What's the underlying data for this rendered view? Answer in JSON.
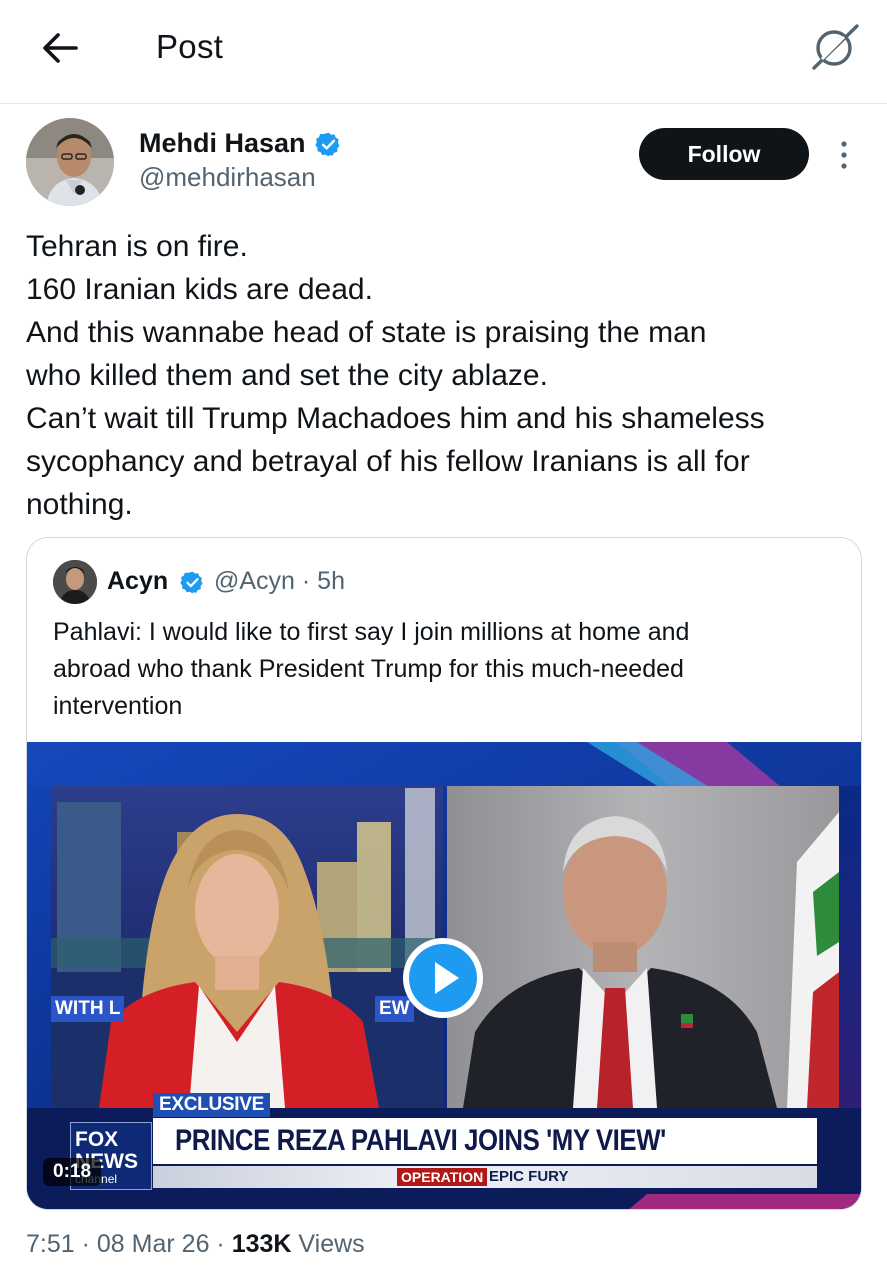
{
  "header": {
    "title": "Post",
    "back_icon": "arrow-left-icon",
    "grok_icon": "grok-icon"
  },
  "author": {
    "name": "Mehdi Hasan",
    "handle": "@mehdirhasan",
    "verified": true,
    "follow_label": "Follow"
  },
  "tweet": {
    "lines": [
      "Tehran is on fire.",
      "160 Iranian kids are dead.",
      "And this wannabe head of state is praising the man",
      "who killed them and set the city ablaze.",
      "Can’t wait till Trump Machadoes him and his shameless",
      "sycophancy and betrayal of his fellow Iranians is all for",
      "nothing."
    ]
  },
  "quote": {
    "name": "Acyn",
    "handle": "@Acyn",
    "time": "5h",
    "meta": "@Acyn · 5h",
    "lines": [
      "Pahlavi: I would like to first say I join millions at home and",
      "abroad who thank President Trump for this much-needed",
      "intervention"
    ],
    "video": {
      "duration": "0:18",
      "exclusive": "EXCLUSIVE",
      "headline": "PRINCE REZA PAHLAVI JOINS 'MY VIEW'",
      "network_line1": "FOX",
      "network_line2": "NEWS",
      "network_line3": "channel",
      "operation_badge": "OPERATION",
      "operation_name": "EPIC FURY",
      "left_label": "WITH L",
      "right_label": "EW"
    }
  },
  "footer": {
    "time": "7:51",
    "date": "08 Mar 26",
    "views_count": "133K",
    "views_label": "Views"
  },
  "colors": {
    "text": "#0f1419",
    "secondary": "#536471",
    "verified": "#1d9bf0",
    "follow_bg": "#0f1419"
  }
}
